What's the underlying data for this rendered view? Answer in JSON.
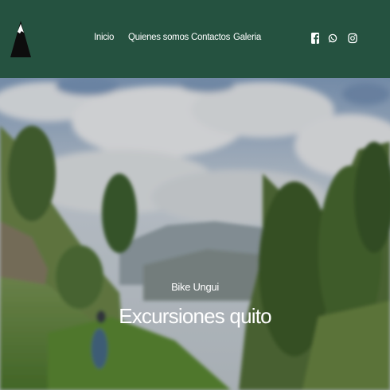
{
  "header": {
    "background_color": "#255240",
    "logo_icon": "mountain-logo-icon",
    "nav": [
      {
        "label": "Inicio"
      },
      {
        "label": "Quienes somos"
      },
      {
        "label": "Contactos"
      },
      {
        "label": "Galeria"
      }
    ],
    "social": [
      {
        "icon": "facebook-icon"
      },
      {
        "icon": "whatsapp-icon"
      },
      {
        "icon": "instagram-icon"
      }
    ]
  },
  "hero": {
    "subtitle": "Bike Ungui",
    "title": "Excursiones quito",
    "background": "mountain-landscape-photo"
  }
}
